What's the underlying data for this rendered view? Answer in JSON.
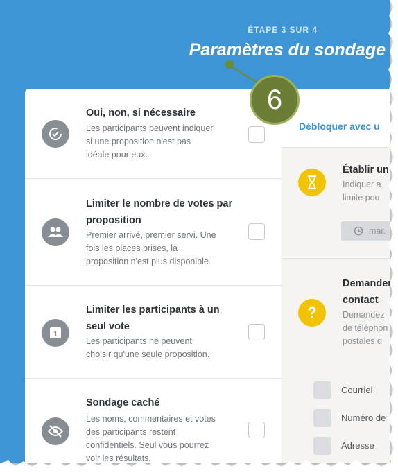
{
  "header": {
    "step": "ÉTAPE 3 SUR 4",
    "title": "Paramètres du sondage"
  },
  "callout": {
    "number": "6"
  },
  "options": [
    {
      "title": "Oui, non, si nécessaire",
      "desc": [
        "Les participants peuvent indiquer",
        "si une proposition n'est pas",
        "idéale pour eux."
      ],
      "icon": "check-circle-icon"
    },
    {
      "title": [
        "Limiter le nombre de votes par",
        "proposition"
      ],
      "desc": [
        "Premier arrivé, premier servi. Une",
        "fois les places prises, la",
        "proposition n'est plus disponible."
      ],
      "icon": "group-icon"
    },
    {
      "title": [
        "Limiter les participants à un",
        "seul vote"
      ],
      "desc": [
        "Les participants ne peuvent",
        "choisir qu'une seule proposition."
      ],
      "icon": "one-vote-icon"
    },
    {
      "title": "Sondage caché",
      "desc": [
        "Les noms, commentaires et votes",
        "des participants restent",
        "confidentiels. Seul vous pourrez",
        "voir les résultats."
      ],
      "icon": "eye-off-icon"
    }
  ],
  "right": {
    "unlock": "Débloquer avec u",
    "deadline": {
      "title": "Établir un",
      "desc": [
        "Indiquer a",
        "limite pou"
      ],
      "date_label": "mar.",
      "icon": "hourglass-icon"
    },
    "contact": {
      "title": [
        "Demander",
        "contact"
      ],
      "desc": [
        "Demandez",
        "de téléphon",
        "postales d"
      ],
      "icon": "question-icon",
      "fields": [
        "Courriel",
        "Numéro de",
        "Adresse"
      ]
    }
  },
  "colors": {
    "header_blue": "#3d95d6",
    "callout_green": "#6b7d35",
    "accent_yellow": "#f2c300",
    "link_blue": "#3d95d6"
  }
}
